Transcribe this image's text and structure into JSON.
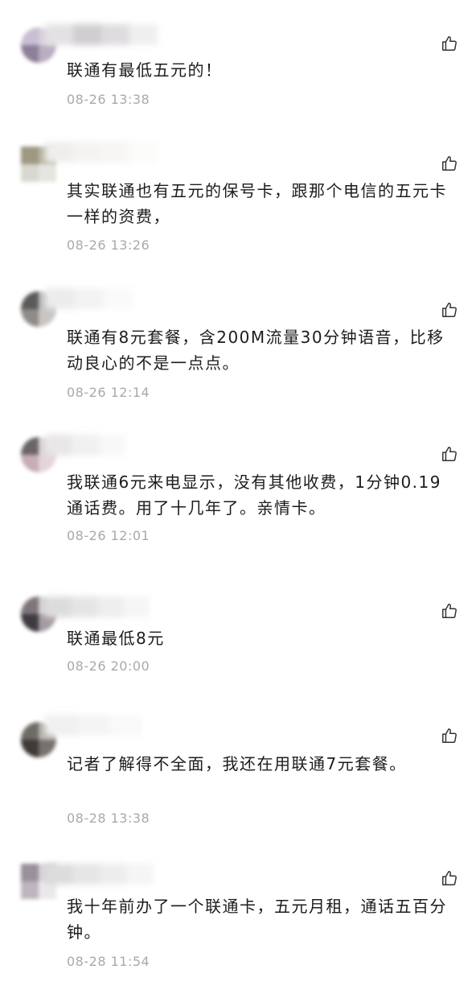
{
  "comments": [
    {
      "text": "联通有最低五元的！",
      "time": "08-26 13:38",
      "like_icon": "thumbs-up-icon"
    },
    {
      "text": "其实联通也有五元的保号卡，跟那个电信的五元卡一样的资费，",
      "time": "08-26 13:26",
      "like_icon": "thumbs-up-icon"
    },
    {
      "text": "联通有8元套餐，含200M流量30分钟语音，比移动良心的不是一点点。",
      "time": "08-26 12:14",
      "like_icon": "thumbs-up-icon"
    },
    {
      "text": "我联通6元来电显示，没有其他收费，1分钟0.19通话费。用了十几年了。亲情卡。",
      "time": "08-26 12:01",
      "like_icon": "thumbs-up-icon"
    },
    {
      "text": "联通最低8元",
      "time": "08-26 20:00",
      "like_icon": "thumbs-up-icon"
    },
    {
      "text": "记者了解得不全面，我还在用联通7元套餐。",
      "time": "08-28 13:38",
      "like_icon": "thumbs-up-icon"
    },
    {
      "text": "我十年前办了一个联通卡，五元月租，通话五百分钟。",
      "time": "08-28 11:54",
      "like_icon": "thumbs-up-icon"
    }
  ]
}
